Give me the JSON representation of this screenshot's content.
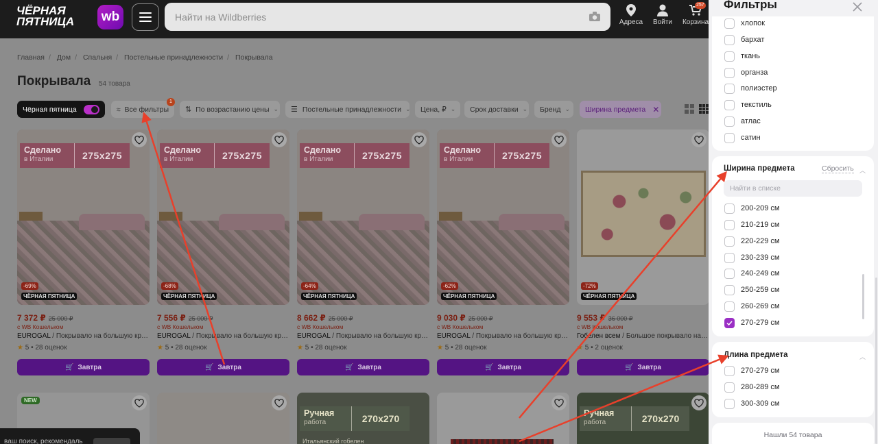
{
  "header": {
    "logo_text_line1": "ЧЁРНАЯ",
    "logo_text_line2": "ПЯТНИЦА",
    "logo_wb": "wb",
    "search_placeholder": "Найти на Wildberries",
    "addresses_label": "Адреса",
    "login_label": "Войти",
    "cart_label": "Корзина",
    "cart_badge": "257"
  },
  "breadcrumbs": [
    "Главная",
    "Дом",
    "Спальня",
    "Постельные принадлежности",
    "Покрывала"
  ],
  "page": {
    "title": "Покрывала",
    "count": "54 товара"
  },
  "filter_bar": {
    "black_friday": "Чёрная пятница",
    "all_filters": "Все фильтры",
    "all_filters_badge": "1",
    "sort": "По возрастанию цены",
    "category": "Постельные принадлежности",
    "price": "Цена, ₽",
    "delivery": "Срок доставки",
    "brand": "Бренд",
    "active_filter": "Ширина предмета"
  },
  "products": [
    {
      "promo_a": "Сделано",
      "promo_sub": "в Италии",
      "promo_b": "275х275",
      "discount": "-69%",
      "bf_tag": "ЧЁРНАЯ ПЯТНИЦА",
      "price": "7 372 ₽",
      "old_price": "25 000 ₽",
      "wallet": "с WB Кошельком",
      "brand": "EUROGAL",
      "name": " / Покрывало на большую кровать",
      "rating": "5",
      "reviews": "28 оценок",
      "button": "Завтра"
    },
    {
      "promo_a": "Сделано",
      "promo_sub": "в Италии",
      "promo_b": "275х275",
      "discount": "-68%",
      "bf_tag": "ЧЁРНАЯ ПЯТНИЦА",
      "price": "7 556 ₽",
      "old_price": "25 000 ₽",
      "wallet": "с WB Кошельком",
      "brand": "EUROGAL",
      "name": " / Покрывало на большую кровать",
      "rating": "5",
      "reviews": "28 оценок",
      "button": "Завтра"
    },
    {
      "promo_a": "Сделано",
      "promo_sub": "в Италии",
      "promo_b": "275х275",
      "discount": "-64%",
      "bf_tag": "ЧЁРНАЯ ПЯТНИЦА",
      "price": "8 662 ₽",
      "old_price": "25 000 ₽",
      "wallet": "с WB Кошельком",
      "brand": "EUROGAL",
      "name": " / Покрывало на большую кровать",
      "rating": "5",
      "reviews": "28 оценок",
      "button": "Завтра"
    },
    {
      "promo_a": "Сделано",
      "promo_sub": "в Италии",
      "promo_b": "275х275",
      "discount": "-62%",
      "bf_tag": "ЧЁРНАЯ ПЯТНИЦА",
      "price": "9 030 ₽",
      "old_price": "25 000 ₽",
      "wallet": "с WB Кошельком",
      "brand": "EUROGAL",
      "name": " / Покрывало на большую кровать",
      "rating": "5",
      "reviews": "28 оценок",
      "button": "Завтра"
    },
    {
      "promo_a": "",
      "promo_sub": "",
      "promo_b": "",
      "discount": "-72%",
      "bf_tag": "ЧЁРНАЯ ПЯТНИЦА",
      "price": "9 553 ₽",
      "old_price": "36 000 ₽",
      "wallet": "с WB Кошельком",
      "brand": "Гобелен всем",
      "name": " / Большое покрывало на кровать",
      "rating": "5",
      "reviews": "2 оценок",
      "button": "Завтра"
    }
  ],
  "row2": {
    "new_badge": "NEW",
    "promo_a": "Ручная",
    "promo_sub": "работа",
    "promo_b": "270х270",
    "subtag": "Итальянский гобелен"
  },
  "toast": {
    "text": "ваш поиск, рекомендаль"
  },
  "filter_panel": {
    "title": "Фильтры",
    "materials": [
      "хлопок",
      "бархат",
      "ткань",
      "органза",
      "полиэстер",
      "текстиль",
      "атлас",
      "сатин"
    ],
    "width_section": {
      "title": "Ширина предмета",
      "reset": "Сбросить",
      "search_placeholder": "Найти в списке",
      "options": [
        "200-209 см",
        "210-219 см",
        "220-229 см",
        "230-239 см",
        "240-249 см",
        "250-259 см",
        "260-269 см",
        "270-279 см"
      ],
      "checked": "270-279 см"
    },
    "length_section": {
      "title": "Длина предмета",
      "options": [
        "270-279 см",
        "280-289 см",
        "300-309 см"
      ]
    },
    "found": "Нашли 54 товара"
  },
  "colors": {
    "accent": "#7b2fbf",
    "discount": "#f25a33",
    "overlay": "#8c8c8c",
    "annotation": "#e8402b"
  }
}
